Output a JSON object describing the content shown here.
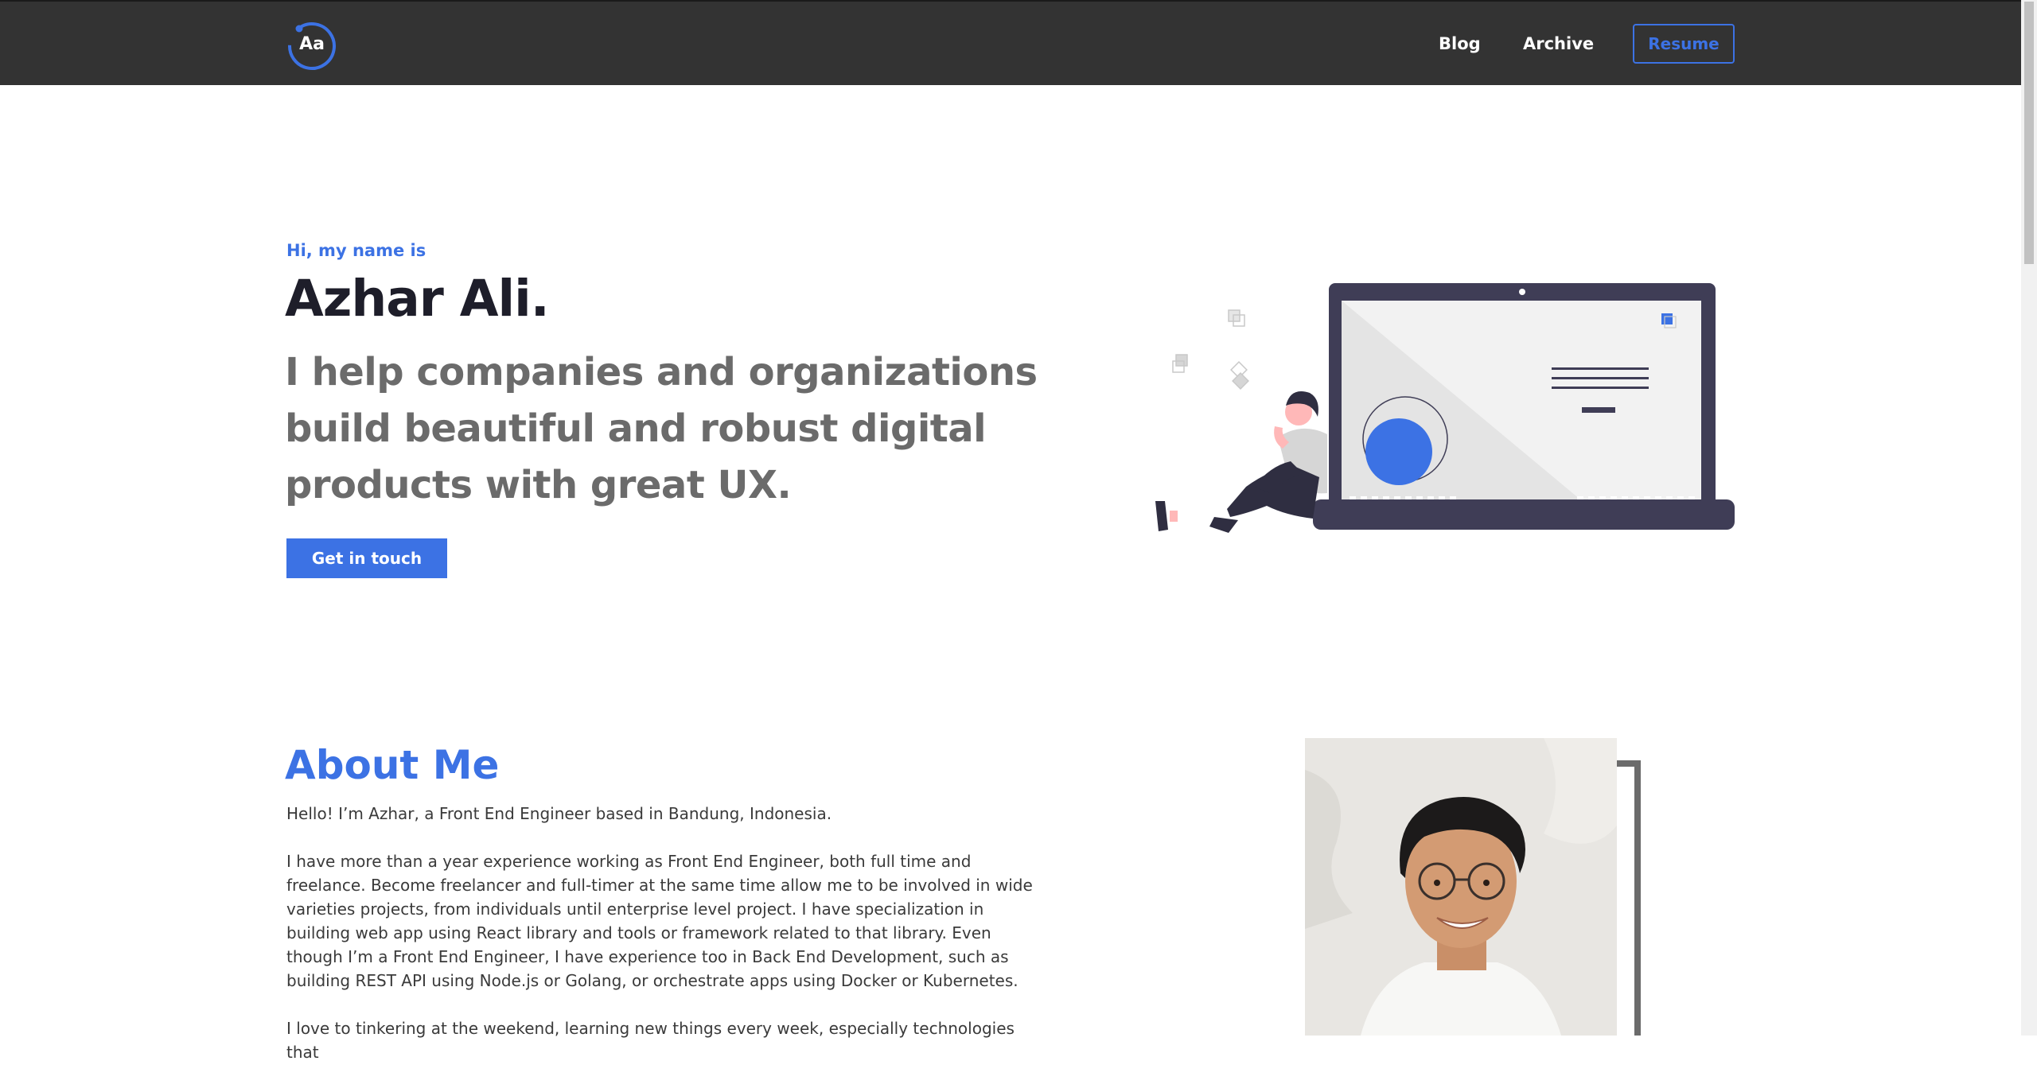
{
  "navbar": {
    "logo_text": "Aa",
    "links": [
      "Blog",
      "Archive"
    ],
    "resume_label": "Resume"
  },
  "hero": {
    "greeting": "Hi, my name is",
    "name": "Azhar Ali.",
    "tagline": "I help companies and organizations build beautiful and robust digital products with great UX.",
    "cta_label": "Get in touch"
  },
  "about": {
    "title": "About Me",
    "paragraphs": [
      "Hello! I’m Azhar, a Front End Engineer based in Bandung, Indonesia.",
      "I have more than a year experience working as Front End Engineer, both full time and freelance. Become freelancer and full-timer at the same time allow me to be involved in wide varieties projects, from individuals until enterprise level project. I have specialization in building web app using React library and tools or framework related to that library. Even though I’m a Front End Engineer, I have experience too in Back End Development, such as building REST API using Node.js or Golang, or orchestrate apps using Docker or Kubernetes.",
      "I love to tinkering at the weekend, learning new things every week, especially technologies that"
    ]
  },
  "colors": {
    "accent": "#3c72e4",
    "navbar_bg": "#333333",
    "heading_dark": "#1e1e2a",
    "tagline_gray": "#6b6b6b",
    "illustration_dark": "#3f3d56"
  },
  "icons": {
    "logo": "circle-logo-icon",
    "hero_art": "laptop-person-illustration",
    "photo": "profile-photo"
  }
}
